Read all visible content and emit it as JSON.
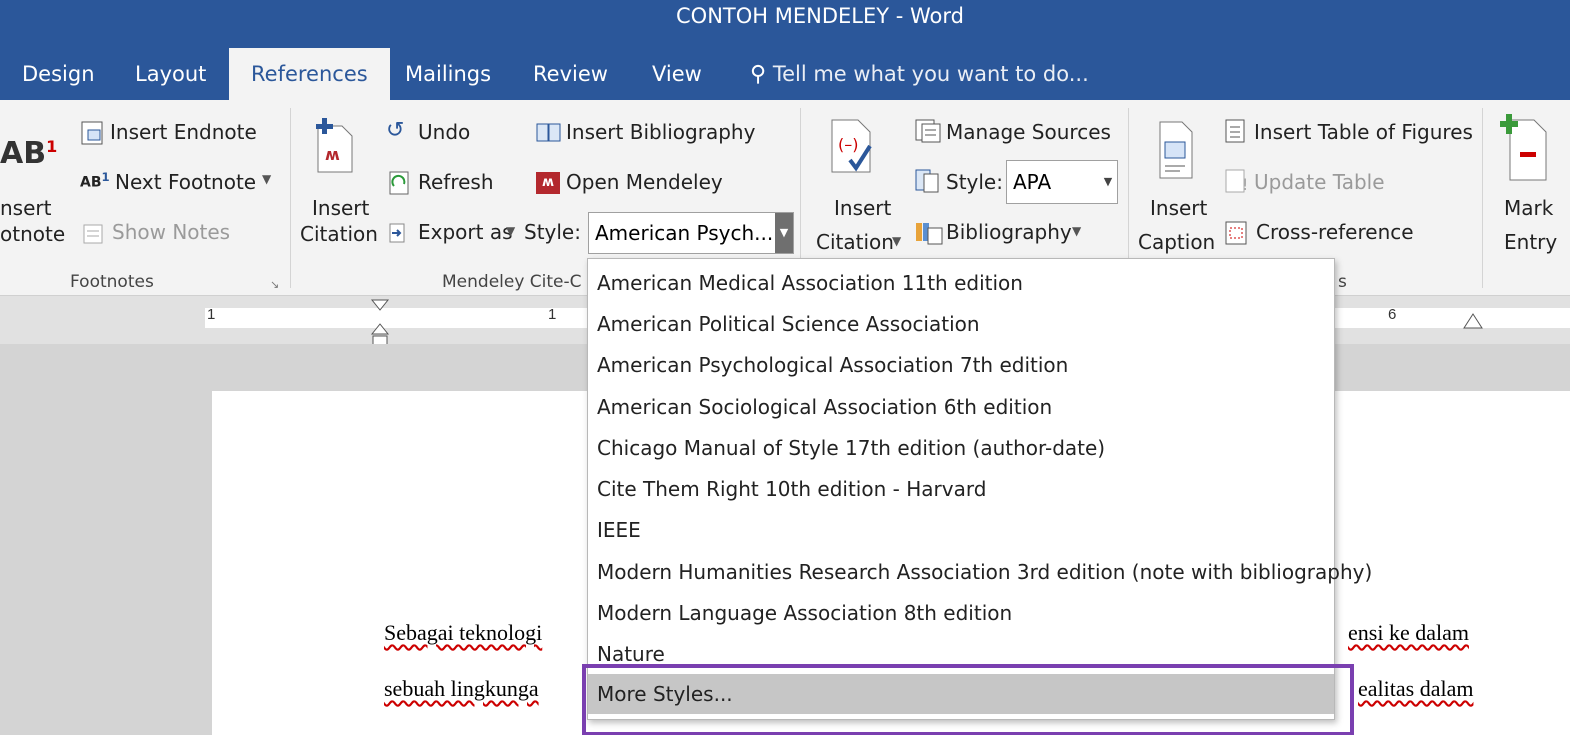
{
  "window": {
    "title": "CONTOH MENDELEY - Word"
  },
  "tabs": [
    {
      "label": "Design"
    },
    {
      "label": "Layout"
    },
    {
      "label": "References"
    },
    {
      "label": "Mailings"
    },
    {
      "label": "Review"
    },
    {
      "label": "View"
    }
  ],
  "tell_me": {
    "placeholder": "Tell me what you want to do..."
  },
  "footnotes": {
    "insert_footnote_line1": "nsert",
    "insert_footnote_line2": "otnote",
    "insert_endnote": "Insert Endnote",
    "next_footnote": "Next Footnote",
    "show_notes": "Show Notes",
    "group_label": "Footnotes"
  },
  "mendeley": {
    "insert_citation_line1": "Insert",
    "insert_citation_line2": "Citation",
    "undo": "Undo",
    "refresh": "Refresh",
    "export_as": "Export as",
    "insert_bibliography": "Insert Bibliography",
    "open_mendeley": "Open Mendeley",
    "style_label": "Style:",
    "style_value": "American Psych...",
    "group_label": "Mendeley Cite-C"
  },
  "citations": {
    "insert_citation_line1": "Insert",
    "insert_citation_line2": "Citation",
    "manage_sources": "Manage Sources",
    "style_label": "Style:",
    "style_value": "APA",
    "bibliography": "Bibliography"
  },
  "captions": {
    "insert_caption_line1": "Insert",
    "insert_caption_line2": "Caption",
    "insert_table_of_figures": "Insert Table of Figures",
    "update_table": "Update Table",
    "cross_reference": "Cross-reference",
    "group_label_tail": "s"
  },
  "index": {
    "mark_entry_line1": "Mark",
    "mark_entry_line2": "Entry"
  },
  "ruler": {
    "labels": [
      "1",
      "1",
      "6"
    ]
  },
  "style_dropdown": {
    "options": [
      "American Medical Association 11th edition",
      "American Political Science Association",
      "American Psychological Association 7th edition",
      "American Sociological Association 6th edition",
      "Chicago Manual of Style 17th edition (author-date)",
      "Cite Them Right 10th edition - Harvard",
      "IEEE",
      "Modern Humanities Research Association 3rd edition (note with bibliography)",
      "Modern Language Association 8th edition",
      "Nature",
      "More Styles..."
    ]
  },
  "document": {
    "line1_left": "Sebagai teknologi",
    "line1_right": "ensi ke dalam",
    "line2_left": "sebuah lingkunga",
    "line2_right": "ealitas dalam"
  },
  "colors": {
    "accent": "#2b579a",
    "highlight_box": "#7a3fb0",
    "mendeley_red": "#b3282d"
  }
}
